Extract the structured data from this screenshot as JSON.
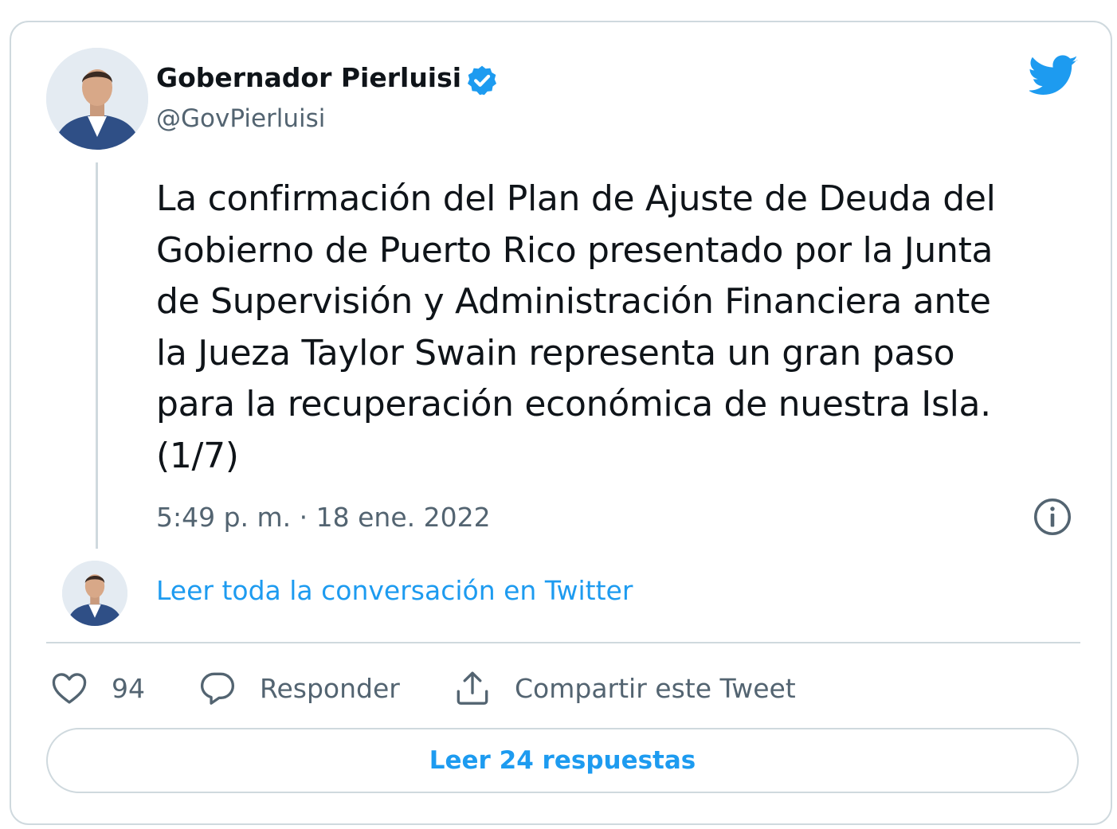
{
  "author": {
    "name": "Gobernador Pierluisi",
    "handle": "@GovPierluisi",
    "verified": true,
    "avatar_icon": "user-avatar"
  },
  "tweet": {
    "text": "La confirmación del Plan de Ajuste de Deuda del\nGobierno de Puerto Rico presentado por la Junta\nde Supervisión y Administración Financiera ante\nla Jueza Taylor Swain representa un gran paso\npara la recuperación económica de nuestra Isla.\n(1/7)",
    "timestamp": "5:49 p. m. · 18 ene. 2022"
  },
  "conversation_link": "Leer toda la conversación en Twitter",
  "actions": {
    "like_count": "94",
    "reply_label": "Responder",
    "share_label": "Compartir este Tweet"
  },
  "replies_button": "Leer 24 respuestas",
  "colors": {
    "accent": "#1d9bf0",
    "text_primary": "#0f1419",
    "text_secondary": "#536471",
    "border": "#cfd9de"
  },
  "icons": [
    "verified-badge-icon",
    "twitter-bird-icon",
    "info-icon",
    "heart-icon",
    "reply-bubble-icon",
    "share-icon"
  ]
}
